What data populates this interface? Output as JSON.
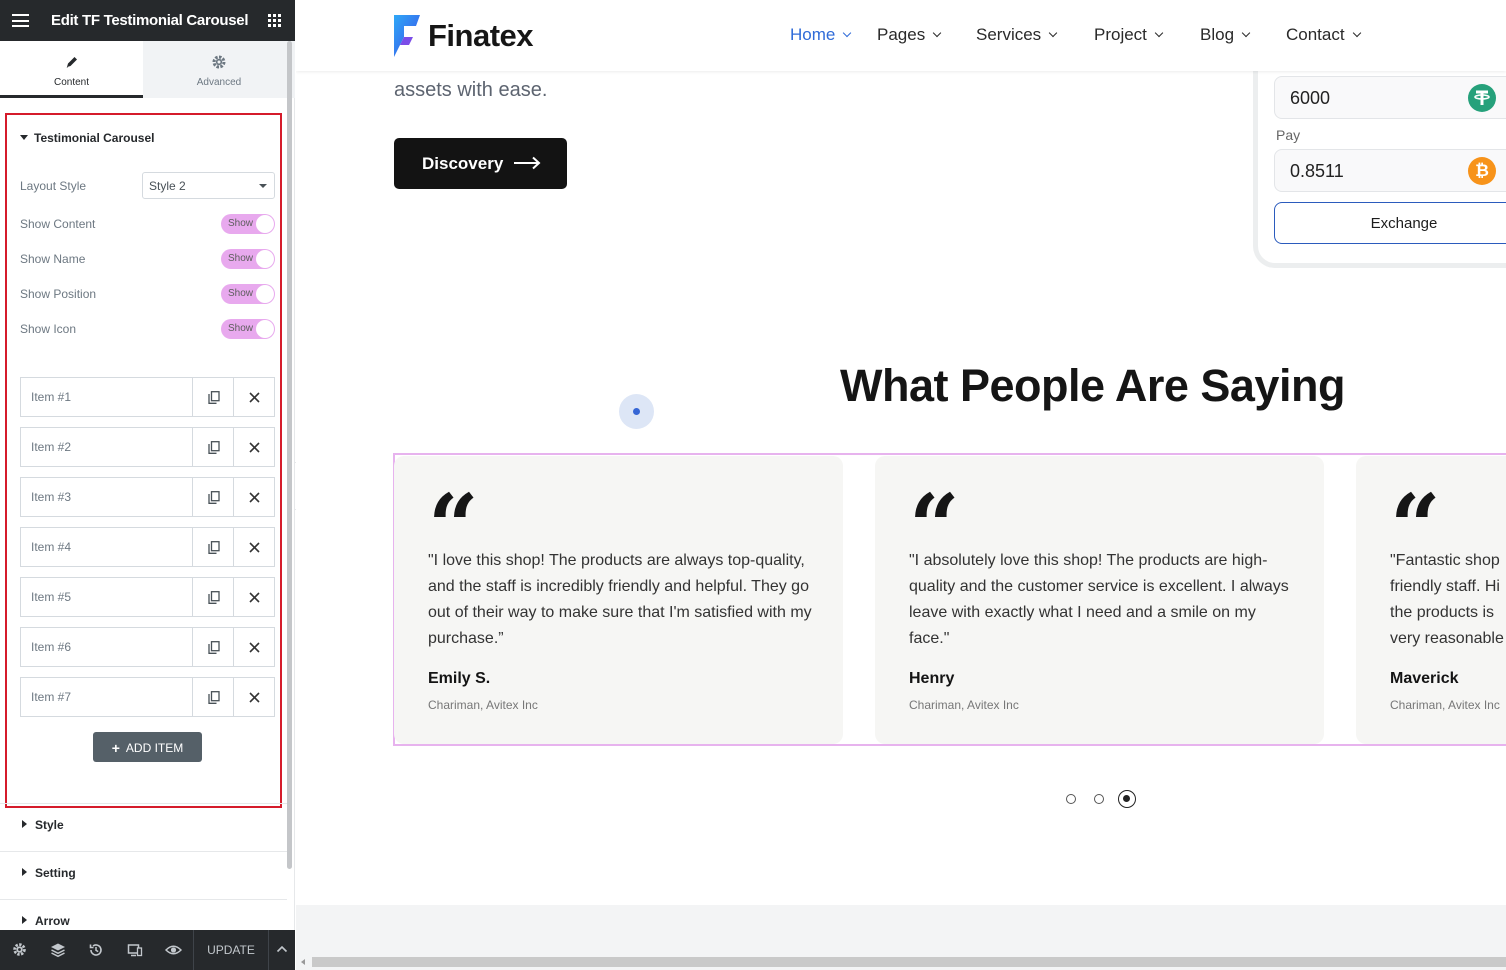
{
  "panel": {
    "header_title": "Edit TF Testimonial Carousel",
    "tabs": [
      {
        "label": "Content",
        "icon": "pencil-icon"
      },
      {
        "label": "Advanced",
        "icon": "gear-icon"
      }
    ],
    "section_title": "Testimonial Carousel",
    "layout_style": {
      "label": "Layout Style",
      "value": "Style 2"
    },
    "toggles": [
      {
        "label": "Show Content",
        "state": "Show"
      },
      {
        "label": "Show Name",
        "state": "Show"
      },
      {
        "label": "Show Position",
        "state": "Show"
      },
      {
        "label": "Show Icon",
        "state": "Show"
      }
    ],
    "items": [
      "Item #1",
      "Item #2",
      "Item #3",
      "Item #4",
      "Item #5",
      "Item #6",
      "Item #7"
    ],
    "add_item": "ADD ITEM",
    "collapsed_sections": [
      "Style",
      "Setting",
      "Arrow"
    ],
    "footer": {
      "update": "UPDATE"
    }
  },
  "site": {
    "logo": "Finatex",
    "nav": [
      "Home",
      "Pages",
      "Services",
      "Project",
      "Blog",
      "Contact"
    ],
    "hero_text": "assets with ease.",
    "discovery_button": "Discovery",
    "exchange": {
      "get_value": "6000",
      "pay_label": "Pay",
      "pay_value": "0.8511",
      "button": "Exchange",
      "tether_color": "#26a17b",
      "bitcoin_color": "#f7931a"
    },
    "section_title": "What People Are Saying",
    "testimonials": [
      {
        "text": "\"I love this shop! The products are always top-quality, and the staff is incredibly friendly and helpful. They go out of their way to make sure that I'm satisfied with my purchase.”",
        "name": "Emily S.",
        "position": "Chariman, Avitex Inc"
      },
      {
        "text": "\"I absolutely love this shop! The products are high-quality and the customer service is excellent. I always leave with exactly what I need and a smile on my face.\"",
        "name": "Henry",
        "position": "Chariman, Avitex Inc"
      },
      {
        "text": "\"Fantastic shop friendly staff. Hi the products is very reasonable",
        "name": "Maverick",
        "position": "Chariman, Avitex Inc"
      }
    ],
    "pagination": {
      "count": 3,
      "active": 3
    }
  },
  "colors": {
    "nav_active": "#2f6bd8",
    "highlight_border": "#d51b2b",
    "toggle_on": "#e8a9ee"
  }
}
